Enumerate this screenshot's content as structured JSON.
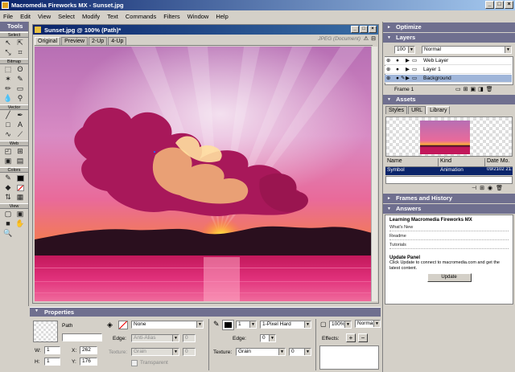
{
  "app": {
    "title": "Macromedia Fireworks MX - Sunset.jpg",
    "window_buttons": [
      "_",
      "□",
      "×"
    ]
  },
  "menu": [
    "File",
    "Edit",
    "View",
    "Select",
    "Modify",
    "Text",
    "Commands",
    "Filters",
    "Window",
    "Help"
  ],
  "tools": {
    "title": "Tools",
    "sections": [
      "Select",
      "Bitmap",
      "Vector",
      "Web",
      "Colors",
      "View"
    ]
  },
  "document": {
    "title": "Sunset.jpg @ 100% (Path)*",
    "tabs": [
      "Original",
      "Preview",
      "2-Up",
      "4-Up"
    ],
    "format_label": "JPEG (Document)"
  },
  "properties": {
    "title": "Properties",
    "object_type": "Path",
    "w_label": "W:",
    "w_value": "1",
    "h_label": "H:",
    "h_value": "1",
    "x_label": "X:",
    "x_value": "262",
    "y_label": "Y:",
    "y_value": "176",
    "fill": "None",
    "edge_label": "Edge:",
    "fill_edge": "Anti-Alias",
    "fill_edge_value": "0",
    "texture_label": "Texture:",
    "fill_texture": "Grain",
    "fill_texture_value": "0",
    "transparent_label": "Transparent",
    "stroke_size": "1",
    "stroke_type": "1-Pixel Hard",
    "stroke_edge_value": "0",
    "stroke_texture": "Grain",
    "stroke_texture_value": "0",
    "opacity": "100%",
    "blend": "Normal",
    "effects_label": "Effects:"
  },
  "panels": {
    "optimize": "Optimize",
    "layers": {
      "title": "Layers",
      "opacity": "100",
      "blend": "Normal",
      "items": [
        {
          "name": "Web Layer"
        },
        {
          "name": "Layer 1"
        },
        {
          "name": "Background"
        }
      ],
      "frame": "Frame 1"
    },
    "assets": {
      "title": "Assets",
      "tabs": [
        "Styles",
        "URL",
        "Library"
      ],
      "columns": [
        "Name",
        "Kind",
        "Date Mo."
      ],
      "row": [
        "Symbol",
        "Animation",
        "09/2102 21:0"
      ]
    },
    "frames_history": "Frames and History",
    "answers": {
      "title": "Answers",
      "heading": "Learning Macromedia Fireworks MX",
      "links": [
        "What's New",
        "Readme",
        "Tutorials"
      ],
      "update_title": "Update Panel",
      "update_text": "Click Update to connect to macromedia.com and get the latest content.",
      "update_button": "Update"
    }
  },
  "colors": {
    "title_bar": "#0a246a",
    "panel_header": "#6f6f8f",
    "selection": "#9fb5d9"
  }
}
